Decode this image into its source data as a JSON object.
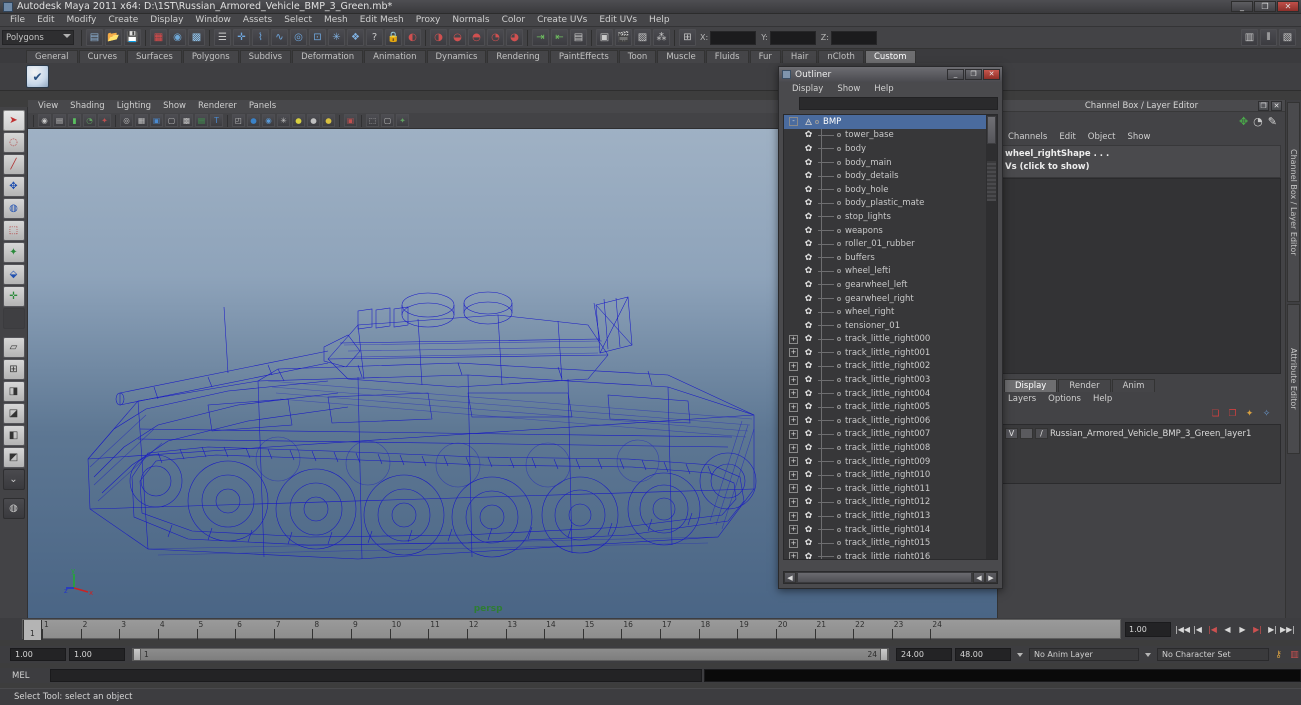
{
  "window": {
    "title": "Autodesk Maya 2011 x64: D:\\1ST\\Russian_Armored_Vehicle_BMP_3_Green.mb*",
    "minimize": "_",
    "maximize": "❐",
    "close": "✕",
    "app_icon": "maya-icon"
  },
  "menubar": [
    "File",
    "Edit",
    "Modify",
    "Create",
    "Display",
    "Window",
    "Assets",
    "Select",
    "Mesh",
    "Edit Mesh",
    "Proxy",
    "Normals",
    "Color",
    "Create UVs",
    "Edit UVs",
    "Help"
  ],
  "toolbar": {
    "mode_selector": "Polygons",
    "coord_labels": [
      "X:",
      "Y:",
      "Z:"
    ],
    "coord_values": [
      "",
      "",
      ""
    ],
    "icons": [
      "new-scene-icon",
      "open-scene-icon",
      "save-scene-icon",
      "undo-icon",
      "redo-icon",
      "redo-all-icon",
      "sequence-icon",
      "select-by-component-icon",
      "snap-grid-icon",
      "snap-curve-icon",
      "snap-point-icon",
      "snap-view-plane-icon",
      "snap-live-icon",
      "construction-history-icon",
      "render-icon",
      "ipr-render-icon",
      "render-settings-icon",
      "lock-icon",
      "hypershade-icon",
      "outliner-layout-icon",
      "persp-outliner-icon",
      "hypergraph-icon"
    ]
  },
  "shelf": {
    "tabs": [
      "General",
      "Curves",
      "Surfaces",
      "Polygons",
      "Subdivs",
      "Deformation",
      "Animation",
      "Dynamics",
      "Rendering",
      "PaintEffects",
      "Toon",
      "Muscle",
      "Fluids",
      "Fur",
      "Hair",
      "nCloth",
      "Custom"
    ],
    "active_tab": "Custom",
    "item_icon": "checkmark-shelf-icon"
  },
  "toolbox": {
    "items": [
      {
        "name": "select-tool",
        "glyph": "➤",
        "style": "sel"
      },
      {
        "name": "lasso-select-tool",
        "glyph": "◌"
      },
      {
        "name": "paint-select-tool",
        "glyph": "🖌"
      },
      {
        "name": "move-tool",
        "glyph": "✥"
      },
      {
        "name": "rotate-tool",
        "glyph": "◍"
      },
      {
        "name": "scale-tool",
        "glyph": "⬚"
      },
      {
        "name": "universal-manipulator-tool",
        "glyph": "✦"
      },
      {
        "name": "soft-modification-tool",
        "glyph": "⬙"
      },
      {
        "name": "show-manipulator-tool",
        "glyph": "✛"
      },
      {
        "name": "last-tool-used",
        "glyph": "",
        "style": "blank"
      },
      {
        "name": "single-perspective-layout",
        "glyph": "▱"
      },
      {
        "name": "four-view-layout",
        "glyph": "⊞"
      },
      {
        "name": "persp-outliner-layout",
        "glyph": "◨"
      },
      {
        "name": "persp-graph-layout",
        "glyph": "◪"
      },
      {
        "name": "hypershade-persp-layout",
        "glyph": "◧"
      },
      {
        "name": "persp-render-layout",
        "glyph": "◩"
      },
      {
        "name": "layout-menu",
        "glyph": "⌄",
        "style": "dark"
      }
    ]
  },
  "viewport": {
    "menus": [
      "View",
      "Shading",
      "Lighting",
      "Show",
      "Renderer",
      "Panels"
    ],
    "camera_label": "persp",
    "axis": {
      "x": "x",
      "y": "y",
      "z": "z",
      "x_color": "#cc2222",
      "y_color": "#22aa33",
      "z_color": "#2233cc"
    },
    "model_name": "Russian Armored Vehicle BMP-3 wireframe",
    "wireframe_color": "#1414c8",
    "bg_top": "#9fb1c4",
    "bg_bottom": "#4a6585",
    "icons": [
      "select-camera-icon",
      "bookmark-icon",
      "image-plane-icon",
      "grid-icon",
      "two-d-pan-zoom-icon",
      "film-gate-icon",
      "resolution-gate-icon",
      "field-chart-icon",
      "safe-action-icon",
      "safe-title-icon",
      "wireframe-icon",
      "smooth-shade-icon",
      "smooth-shade-all-icon",
      "hardware-texture-icon",
      "use-default-light-icon",
      "use-all-lights-icon",
      "shadows-icon",
      "xray-icon",
      "isolate-select-icon",
      "lighting-icon",
      "exposure-icon"
    ]
  },
  "outliner": {
    "title": "Outliner",
    "window_buttons": {
      "minimize": "_",
      "maximize": "❐",
      "close": "✕"
    },
    "menus": [
      "Display",
      "Show",
      "Help"
    ],
    "search_value": "",
    "root": {
      "label": "BMP",
      "icon": "transform-node-icon",
      "selected": true,
      "expander": "-"
    },
    "items": [
      {
        "label": "tower_base",
        "icon": "mesh-node-icon",
        "expander": ""
      },
      {
        "label": "body",
        "icon": "mesh-node-icon",
        "expander": ""
      },
      {
        "label": "body_main",
        "icon": "mesh-node-icon",
        "expander": ""
      },
      {
        "label": "body_details",
        "icon": "mesh-node-icon",
        "expander": ""
      },
      {
        "label": "body_hole",
        "icon": "mesh-node-icon",
        "expander": ""
      },
      {
        "label": "body_plastic_mate",
        "icon": "mesh-node-icon",
        "expander": ""
      },
      {
        "label": "stop_lights",
        "icon": "mesh-node-icon",
        "expander": ""
      },
      {
        "label": "weapons",
        "icon": "mesh-node-icon",
        "expander": ""
      },
      {
        "label": "roller_01_rubber",
        "icon": "mesh-node-icon",
        "expander": ""
      },
      {
        "label": "buffers",
        "icon": "mesh-node-icon",
        "expander": ""
      },
      {
        "label": "wheel_lefti",
        "icon": "mesh-node-icon",
        "expander": ""
      },
      {
        "label": "gearwheel_left",
        "icon": "mesh-node-icon",
        "expander": ""
      },
      {
        "label": "gearwheel_right",
        "icon": "mesh-node-icon",
        "expander": ""
      },
      {
        "label": "wheel_right",
        "icon": "mesh-node-icon",
        "expander": ""
      },
      {
        "label": "tensioner_01",
        "icon": "mesh-node-icon",
        "expander": ""
      },
      {
        "label": "track_little_right000",
        "icon": "mesh-node-icon",
        "expander": "+"
      },
      {
        "label": "track_little_right001",
        "icon": "mesh-node-icon",
        "expander": "+"
      },
      {
        "label": "track_little_right002",
        "icon": "mesh-node-icon",
        "expander": "+"
      },
      {
        "label": "track_little_right003",
        "icon": "mesh-node-icon",
        "expander": "+"
      },
      {
        "label": "track_little_right004",
        "icon": "mesh-node-icon",
        "expander": "+"
      },
      {
        "label": "track_little_right005",
        "icon": "mesh-node-icon",
        "expander": "+"
      },
      {
        "label": "track_little_right006",
        "icon": "mesh-node-icon",
        "expander": "+"
      },
      {
        "label": "track_little_right007",
        "icon": "mesh-node-icon",
        "expander": "+"
      },
      {
        "label": "track_little_right008",
        "icon": "mesh-node-icon",
        "expander": "+"
      },
      {
        "label": "track_little_right009",
        "icon": "mesh-node-icon",
        "expander": "+"
      },
      {
        "label": "track_little_right010",
        "icon": "mesh-node-icon",
        "expander": "+"
      },
      {
        "label": "track_little_right011",
        "icon": "mesh-node-icon",
        "expander": "+"
      },
      {
        "label": "track_little_right012",
        "icon": "mesh-node-icon",
        "expander": "+"
      },
      {
        "label": "track_little_right013",
        "icon": "mesh-node-icon",
        "expander": "+"
      },
      {
        "label": "track_little_right014",
        "icon": "mesh-node-icon",
        "expander": "+"
      },
      {
        "label": "track_little_right015",
        "icon": "mesh-node-icon",
        "expander": "+"
      },
      {
        "label": "track_little_right016",
        "icon": "mesh-node-icon",
        "expander": "+"
      }
    ],
    "scroll_left": "◀",
    "scroll_right": "▶"
  },
  "channel_box": {
    "title": "Channel Box / Layer Editor",
    "float_btn": "❐",
    "close_btn": "✕",
    "header_icons": [
      "channel-box-icon",
      "anim-layer-icon",
      "render-layer-icon"
    ],
    "menus": [
      "Channels",
      "Edit",
      "Object",
      "Show"
    ],
    "shape_label": "wheel_rightShape . . .",
    "sub_label": "Vs (click to show)"
  },
  "layer_editor": {
    "tabs": [
      "Display",
      "Render",
      "Anim"
    ],
    "active_tab": "Display",
    "menus": [
      "Layers",
      "Options",
      "Help"
    ],
    "buttons": [
      "new-layer-icon",
      "new-layer-from-selected-icon",
      "layer-membership-icon",
      "layer-attributes-icon"
    ],
    "layers": [
      {
        "visibility": "V",
        "playback": "",
        "display_type": "/",
        "name": "Russian_Armored_Vehicle_BMP_3_Green_layer1"
      }
    ]
  },
  "side_tabs": [
    "Channel Box / Layer Editor",
    "Attribute Editor"
  ],
  "timeline": {
    "frame_ticks": [
      "1",
      "2",
      "3",
      "4",
      "5",
      "6",
      "7",
      "8",
      "9",
      "10",
      "11",
      "12",
      "13",
      "14",
      "15",
      "16",
      "17",
      "18",
      "19",
      "20",
      "21",
      "22",
      "23",
      "24"
    ],
    "current_frame_label": "1",
    "current_frame_field": "1.00",
    "playback_buttons": [
      "go-to-start-icon",
      "step-back-frame-icon",
      "step-back-key-icon",
      "play-backwards-icon",
      "play-forwards-icon",
      "step-forward-key-icon",
      "step-forward-frame-icon",
      "go-to-end-icon"
    ]
  },
  "range": {
    "anim_start": "1.00",
    "range_start": "1.00",
    "slider_start": "1",
    "slider_end": "24",
    "range_end": "24.00",
    "anim_end": "48.00",
    "anim_layer": "No Anim Layer",
    "character_set": "No Character Set",
    "auto_key_icon": "auto-key-icon",
    "anim_prefs_icon": "animation-preferences-icon"
  },
  "command_line": {
    "label": "MEL",
    "input_value": "",
    "output_value": ""
  },
  "status": {
    "help_line": "Select Tool: select an object"
  }
}
